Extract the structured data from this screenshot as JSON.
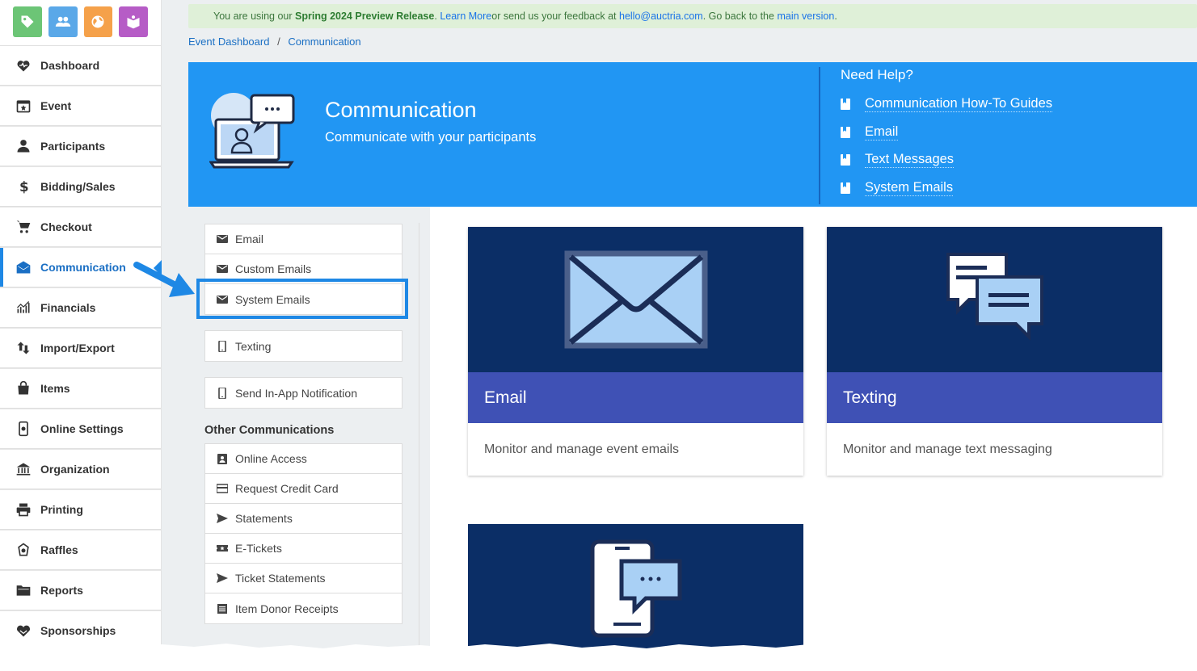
{
  "app_icons": [
    {
      "name": "tag-icon",
      "color": "#6cc576"
    },
    {
      "name": "people-icon",
      "color": "#5aa8e8"
    },
    {
      "name": "globe-icon",
      "color": "#f5a14a"
    },
    {
      "name": "book-icon",
      "color": "#b65cc6"
    }
  ],
  "sidebar": {
    "items": [
      {
        "label": "Dashboard",
        "icon": "dashboard-icon"
      },
      {
        "label": "Event",
        "icon": "calendar-icon"
      },
      {
        "label": "Participants",
        "icon": "person-icon"
      },
      {
        "label": "Bidding/Sales",
        "icon": "dollar-icon"
      },
      {
        "label": "Checkout",
        "icon": "cart-icon"
      },
      {
        "label": "Communication",
        "icon": "envelope-open-icon",
        "active": true
      },
      {
        "label": "Financials",
        "icon": "chart-icon"
      },
      {
        "label": "Import/Export",
        "icon": "import-export-icon"
      },
      {
        "label": "Items",
        "icon": "bag-icon"
      },
      {
        "label": "Online Settings",
        "icon": "online-settings-icon"
      },
      {
        "label": "Organization",
        "icon": "building-icon"
      },
      {
        "label": "Printing",
        "icon": "printer-icon"
      },
      {
        "label": "Raffles",
        "icon": "raffle-icon"
      },
      {
        "label": "Reports",
        "icon": "folder-icon"
      },
      {
        "label": "Sponsorships",
        "icon": "handshake-icon"
      }
    ]
  },
  "banner": {
    "prefix": "You are using our ",
    "release": "Spring 2024 Preview Release",
    "dot": ". ",
    "learn_more": "Learn More",
    "middle": " or send us your feedback at ",
    "email": "hello@auctria.com",
    "go_back": ". Go back to the ",
    "main_version": "main version",
    "end": "."
  },
  "breadcrumb": {
    "parent": "Event Dashboard",
    "sep": "/",
    "current": "Communication"
  },
  "hero": {
    "title": "Communication",
    "subtitle": "Communicate with your participants",
    "help_title": "Need Help?",
    "help_links": [
      "Communication How-To Guides",
      "Email",
      "Text Messages",
      "System Emails"
    ]
  },
  "menu": {
    "email_group": [
      {
        "label": "Email",
        "icon": "envelope-icon"
      },
      {
        "label": "Custom Emails",
        "icon": "envelope-icon"
      },
      {
        "label": "System Emails",
        "icon": "envelope-icon"
      }
    ],
    "texting": {
      "label": "Texting",
      "icon": "phone-icon"
    },
    "inapp": {
      "label": "Send In-App Notification",
      "icon": "phone-icon"
    },
    "other_title": "Other Communications",
    "other": [
      {
        "label": "Online Access",
        "icon": "badge-icon"
      },
      {
        "label": "Request Credit Card",
        "icon": "credit-card-icon"
      },
      {
        "label": "Statements",
        "icon": "send-icon"
      },
      {
        "label": "E-Tickets",
        "icon": "ticket-icon"
      },
      {
        "label": "Ticket Statements",
        "icon": "send-icon"
      },
      {
        "label": "Item Donor Receipts",
        "icon": "receipt-icon"
      }
    ]
  },
  "cards": [
    {
      "title": "Email",
      "desc": "Monitor and manage event emails",
      "icon": "envelope-large-icon"
    },
    {
      "title": "Texting",
      "desc": "Monitor and manage text messaging",
      "icon": "chat-bubbles-icon"
    },
    {
      "title": "",
      "desc": "",
      "icon": "phone-chat-icon"
    }
  ],
  "colors": {
    "accent": "#1e88e5",
    "hero": "#2196f3",
    "card_dark": "#0b2e66",
    "card_head": "#3f51b5"
  }
}
